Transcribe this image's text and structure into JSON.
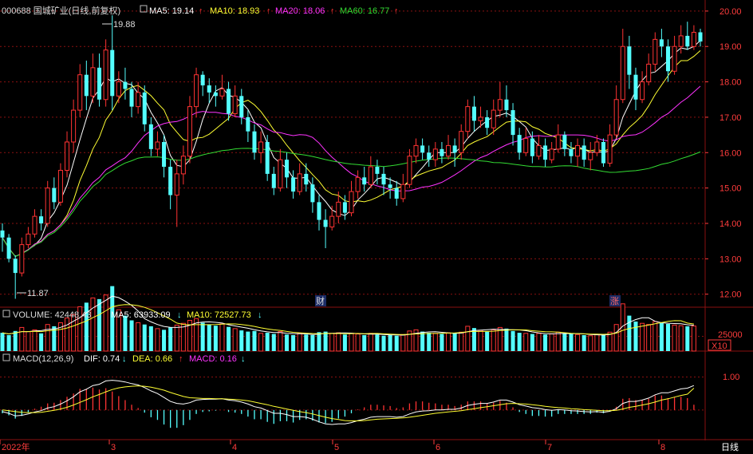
{
  "colors": {
    "up": "#ff3333",
    "down": "#54ffff",
    "ma5": "#ffffff",
    "ma10": "#ffff33",
    "ma20": "#ff33ff",
    "ma60": "#33dd33",
    "grid": "#8a1010",
    "axis_text": "#ff3c3c"
  },
  "header": {
    "code_name": "000688 国城矿业(日线,前复权)",
    "ma5_label": "MA5: 19.14",
    "ma10_label": "MA10: 18.93",
    "ma20_label": "MA20: 18.06",
    "ma60_label": "MA60: 16.77",
    "arrow_up": "↑",
    "arrow_down": "↓"
  },
  "volume_header": {
    "volume_label": "VOLUME: 42448.43",
    "ma5_label": "MA5: 63933.09",
    "ma10_label": "MA10: 72527.73"
  },
  "macd_header": {
    "title": "MACD(12,26,9)",
    "dif_label": "DIF: 0.74",
    "dea_label": "DEA: 0.66",
    "macd_label": "MACD: 0.16"
  },
  "markers": {
    "high_label": "19.88",
    "low_label": "11.87",
    "cai_label": "财",
    "zhang_label": "涨"
  },
  "y_axis_price": [
    "20.00",
    "19.00",
    "18.00",
    "17.00",
    "16.00",
    "15.00",
    "14.00",
    "13.00",
    "12.00"
  ],
  "y_axis_volume": [
    "25000",
    "X10"
  ],
  "y_axis_macd": [
    "1.00"
  ],
  "x_axis": {
    "labels": [
      "2022年",
      "3",
      "4",
      "5",
      "6",
      "7",
      "8"
    ],
    "period": "日线"
  },
  "chart_data": {
    "type": "candlestick",
    "ylim": [
      11.7,
      20.2
    ],
    "volume_ylim": [
      0,
      50000
    ],
    "macd_ylim": [
      -0.85,
      1.35
    ],
    "candles": [
      [
        13.8,
        13.6,
        14.0,
        13.2
      ],
      [
        13.6,
        13.0,
        13.7,
        12.9
      ],
      [
        13.0,
        12.6,
        13.1,
        11.87
      ],
      [
        12.6,
        13.4,
        13.6,
        12.5
      ],
      [
        13.4,
        13.7,
        13.9,
        13.3
      ],
      [
        13.7,
        14.2,
        14.4,
        13.6
      ],
      [
        14.2,
        14.0,
        14.4,
        13.8
      ],
      [
        14.0,
        15.0,
        15.2,
        13.9
      ],
      [
        15.0,
        14.6,
        15.3,
        14.4
      ],
      [
        14.6,
        15.5,
        15.7,
        14.5
      ],
      [
        15.5,
        16.3,
        16.6,
        15.3
      ],
      [
        16.3,
        17.2,
        17.5,
        16.0
      ],
      [
        17.2,
        18.2,
        18.5,
        17.0
      ],
      [
        18.2,
        17.6,
        18.6,
        17.2
      ],
      [
        17.6,
        18.4,
        18.8,
        17.4
      ],
      [
        18.4,
        17.5,
        18.8,
        17.3
      ],
      [
        17.5,
        18.9,
        19.2,
        17.3
      ],
      [
        18.9,
        17.6,
        19.88,
        17.2
      ],
      [
        17.6,
        18.0,
        18.3,
        17.4
      ],
      [
        18.0,
        17.8,
        18.4,
        17.5
      ],
      [
        17.8,
        17.3,
        18.0,
        17.0
      ],
      [
        17.3,
        17.7,
        18.0,
        17.1
      ],
      [
        17.7,
        16.8,
        17.9,
        16.6
      ],
      [
        16.8,
        16.1,
        17.0,
        15.9
      ],
      [
        16.1,
        16.3,
        16.6,
        15.9
      ],
      [
        16.3,
        15.6,
        16.5,
        15.3
      ],
      [
        15.6,
        14.8,
        15.8,
        14.4
      ],
      [
        14.8,
        15.4,
        15.8,
        13.9
      ],
      [
        15.4,
        15.9,
        16.2,
        15.1
      ],
      [
        15.9,
        17.3,
        17.6,
        15.7
      ],
      [
        17.3,
        18.2,
        18.4,
        17.0
      ],
      [
        18.2,
        17.9,
        18.3,
        17.6
      ],
      [
        17.9,
        17.7,
        18.1,
        17.4
      ],
      [
        17.7,
        17.6,
        17.9,
        17.3
      ],
      [
        17.6,
        17.8,
        18.2,
        17.5
      ],
      [
        17.8,
        17.1,
        18.0,
        16.9
      ],
      [
        17.1,
        17.6,
        17.9,
        17.0
      ],
      [
        17.6,
        17.0,
        17.8,
        16.8
      ],
      [
        17.0,
        16.6,
        17.2,
        16.3
      ],
      [
        16.6,
        16.0,
        16.8,
        15.8
      ],
      [
        16.0,
        16.3,
        16.6,
        15.7
      ],
      [
        16.3,
        15.4,
        16.5,
        15.2
      ],
      [
        15.4,
        15.0,
        15.6,
        14.8
      ],
      [
        15.0,
        15.8,
        16.1,
        14.9
      ],
      [
        15.8,
        15.3,
        16.0,
        15.0
      ],
      [
        15.3,
        14.9,
        15.5,
        14.7
      ],
      [
        14.9,
        15.4,
        15.7,
        14.8
      ],
      [
        15.4,
        15.1,
        15.7,
        14.9
      ],
      [
        15.1,
        14.6,
        15.3,
        14.3
      ],
      [
        14.6,
        14.1,
        14.8,
        13.8
      ],
      [
        14.1,
        13.9,
        14.4,
        13.3
      ],
      [
        13.9,
        14.2,
        14.5,
        13.8
      ],
      [
        14.2,
        14.6,
        14.9,
        14.0
      ],
      [
        14.6,
        14.3,
        14.8,
        14.1
      ],
      [
        14.3,
        14.9,
        15.2,
        14.2
      ],
      [
        14.9,
        15.3,
        15.5,
        14.7
      ],
      [
        15.3,
        15.1,
        15.6,
        14.9
      ],
      [
        15.1,
        15.6,
        15.9,
        15.0
      ],
      [
        15.6,
        15.4,
        15.8,
        15.1
      ],
      [
        15.4,
        15.1,
        15.6,
        14.8
      ],
      [
        15.1,
        15.0,
        15.3,
        14.7
      ],
      [
        15.0,
        14.7,
        15.2,
        14.5
      ],
      [
        14.7,
        15.1,
        15.4,
        14.6
      ],
      [
        15.1,
        15.9,
        16.1,
        15.0
      ],
      [
        15.9,
        16.2,
        16.4,
        15.7
      ],
      [
        16.2,
        16.0,
        16.4,
        15.8
      ],
      [
        16.0,
        15.8,
        16.2,
        15.6
      ],
      [
        15.8,
        16.1,
        16.3,
        15.6
      ],
      [
        16.1,
        15.9,
        16.3,
        15.7
      ],
      [
        15.9,
        16.2,
        16.5,
        15.8
      ],
      [
        16.2,
        16.0,
        16.4,
        15.6
      ],
      [
        16.0,
        16.6,
        16.8,
        15.8
      ],
      [
        16.6,
        17.3,
        17.5,
        16.4
      ],
      [
        17.3,
        16.9,
        17.6,
        16.6
      ],
      [
        16.9,
        17.0,
        17.3,
        16.7
      ],
      [
        17.0,
        16.7,
        17.2,
        16.5
      ],
      [
        16.7,
        17.2,
        17.5,
        16.5
      ],
      [
        17.2,
        17.5,
        18.0,
        17.0
      ],
      [
        17.5,
        17.2,
        17.9,
        17.0
      ],
      [
        17.2,
        16.5,
        17.4,
        16.2
      ],
      [
        16.5,
        16.0,
        16.7,
        15.8
      ],
      [
        16.0,
        16.4,
        16.7,
        15.9
      ],
      [
        16.4,
        15.9,
        16.6,
        15.7
      ],
      [
        15.9,
        16.2,
        16.5,
        15.8
      ],
      [
        16.2,
        15.8,
        16.4,
        15.6
      ],
      [
        15.8,
        16.1,
        16.3,
        15.7
      ],
      [
        16.1,
        16.5,
        16.8,
        16.0
      ],
      [
        16.5,
        16.1,
        16.6,
        15.9
      ],
      [
        16.1,
        15.9,
        16.3,
        15.7
      ],
      [
        15.9,
        16.2,
        16.4,
        15.6
      ],
      [
        16.2,
        15.8,
        16.4,
        15.6
      ],
      [
        15.8,
        16.0,
        16.3,
        15.5
      ],
      [
        16.0,
        16.3,
        16.5,
        15.9
      ],
      [
        16.3,
        15.7,
        16.4,
        15.6
      ],
      [
        15.7,
        16.5,
        16.8,
        15.6
      ],
      [
        16.5,
        17.5,
        17.9,
        16.4
      ],
      [
        17.5,
        19.0,
        19.5,
        17.4
      ],
      [
        19.0,
        18.2,
        19.3,
        17.8
      ],
      [
        18.2,
        17.5,
        18.4,
        17.2
      ],
      [
        17.5,
        18.0,
        18.3,
        17.4
      ],
      [
        18.0,
        18.5,
        18.8,
        17.9
      ],
      [
        18.5,
        19.2,
        19.4,
        18.3
      ],
      [
        19.2,
        19.0,
        19.5,
        18.7
      ],
      [
        19.0,
        18.3,
        19.2,
        18.0
      ],
      [
        18.3,
        19.0,
        19.3,
        18.2
      ],
      [
        19.0,
        19.3,
        19.6,
        18.8
      ],
      [
        19.3,
        19.0,
        19.7,
        18.9
      ],
      [
        19.0,
        19.4,
        19.6,
        18.9
      ],
      [
        19.4,
        19.14,
        19.5,
        19.0
      ]
    ],
    "volume": [
      31000,
      27000,
      34000,
      40000,
      33000,
      36000,
      30000,
      45000,
      42000,
      48000,
      56000,
      62000,
      75000,
      82000,
      90000,
      88000,
      95000,
      110000,
      70000,
      60000,
      52000,
      48000,
      45000,
      42000,
      38000,
      36000,
      40000,
      44000,
      47000,
      52000,
      55000,
      48000,
      45000,
      43000,
      46000,
      41000,
      38000,
      35000,
      33000,
      34000,
      30000,
      31000,
      29000,
      33000,
      28000,
      27000,
      30000,
      28000,
      27000,
      32000,
      33000,
      30000,
      31000,
      28000,
      30000,
      29000,
      27000,
      30000,
      28000,
      26000,
      27000,
      26000,
      28000,
      34000,
      36000,
      33000,
      31000,
      30000,
      29000,
      31000,
      30000,
      32000,
      42000,
      39000,
      35000,
      33000,
      36000,
      40000,
      38000,
      34000,
      31000,
      30000,
      29000,
      30000,
      28000,
      29000,
      32000,
      30000,
      29000,
      28000,
      27000,
      26000,
      28000,
      27000,
      32000,
      45000,
      80000,
      60000,
      50000,
      47000,
      45000,
      50000,
      48000,
      46000,
      44000,
      43000,
      42000,
      42448
    ],
    "macd_dif": [
      -0.05,
      -0.1,
      -0.18,
      -0.16,
      -0.12,
      -0.06,
      -0.02,
      0.06,
      0.1,
      0.18,
      0.28,
      0.4,
      0.55,
      0.63,
      0.74,
      0.78,
      0.88,
      0.9,
      0.88,
      0.85,
      0.8,
      0.76,
      0.68,
      0.58,
      0.5,
      0.38,
      0.26,
      0.2,
      0.18,
      0.22,
      0.3,
      0.32,
      0.33,
      0.33,
      0.34,
      0.3,
      0.28,
      0.24,
      0.18,
      0.1,
      0.06,
      -0.02,
      -0.1,
      -0.1,
      -0.14,
      -0.2,
      -0.2,
      -0.22,
      -0.28,
      -0.36,
      -0.42,
      -0.44,
      -0.42,
      -0.42,
      -0.38,
      -0.32,
      -0.28,
      -0.22,
      -0.2,
      -0.2,
      -0.2,
      -0.22,
      -0.2,
      -0.12,
      -0.06,
      -0.03,
      -0.02,
      0.0,
      0.0,
      0.02,
      0.02,
      0.06,
      0.14,
      0.17,
      0.2,
      0.2,
      0.24,
      0.3,
      0.3,
      0.24,
      0.16,
      0.12,
      0.07,
      0.05,
      0.01,
      -0.01,
      0.01,
      0.0,
      -0.02,
      -0.03,
      -0.05,
      -0.06,
      -0.05,
      -0.07,
      -0.04,
      0.04,
      0.2,
      0.26,
      0.26,
      0.3,
      0.36,
      0.46,
      0.52,
      0.52,
      0.58,
      0.64,
      0.66,
      0.74
    ],
    "macd_dea": [
      0.0,
      -0.02,
      -0.05,
      -0.07,
      -0.08,
      -0.08,
      -0.07,
      -0.04,
      -0.01,
      0.03,
      0.08,
      0.15,
      0.23,
      0.31,
      0.4,
      0.47,
      0.55,
      0.62,
      0.67,
      0.7,
      0.72,
      0.73,
      0.72,
      0.69,
      0.65,
      0.6,
      0.53,
      0.47,
      0.41,
      0.37,
      0.36,
      0.35,
      0.35,
      0.34,
      0.34,
      0.33,
      0.32,
      0.3,
      0.28,
      0.24,
      0.2,
      0.16,
      0.11,
      0.07,
      0.03,
      -0.01,
      -0.05,
      -0.08,
      -0.12,
      -0.17,
      -0.22,
      -0.26,
      -0.29,
      -0.32,
      -0.33,
      -0.33,
      -0.32,
      -0.3,
      -0.28,
      -0.27,
      -0.26,
      -0.25,
      -0.24,
      -0.22,
      -0.19,
      -0.16,
      -0.13,
      -0.1,
      -0.08,
      -0.06,
      -0.04,
      -0.02,
      0.01,
      0.04,
      0.07,
      0.1,
      0.13,
      0.16,
      0.19,
      0.2,
      0.19,
      0.18,
      0.16,
      0.14,
      0.11,
      0.09,
      0.07,
      0.06,
      0.04,
      0.03,
      0.01,
      0.0,
      -0.01,
      -0.02,
      -0.02,
      -0.01,
      0.03,
      0.08,
      0.11,
      0.15,
      0.19,
      0.24,
      0.3,
      0.34,
      0.39,
      0.44,
      0.48,
      0.66
    ]
  }
}
